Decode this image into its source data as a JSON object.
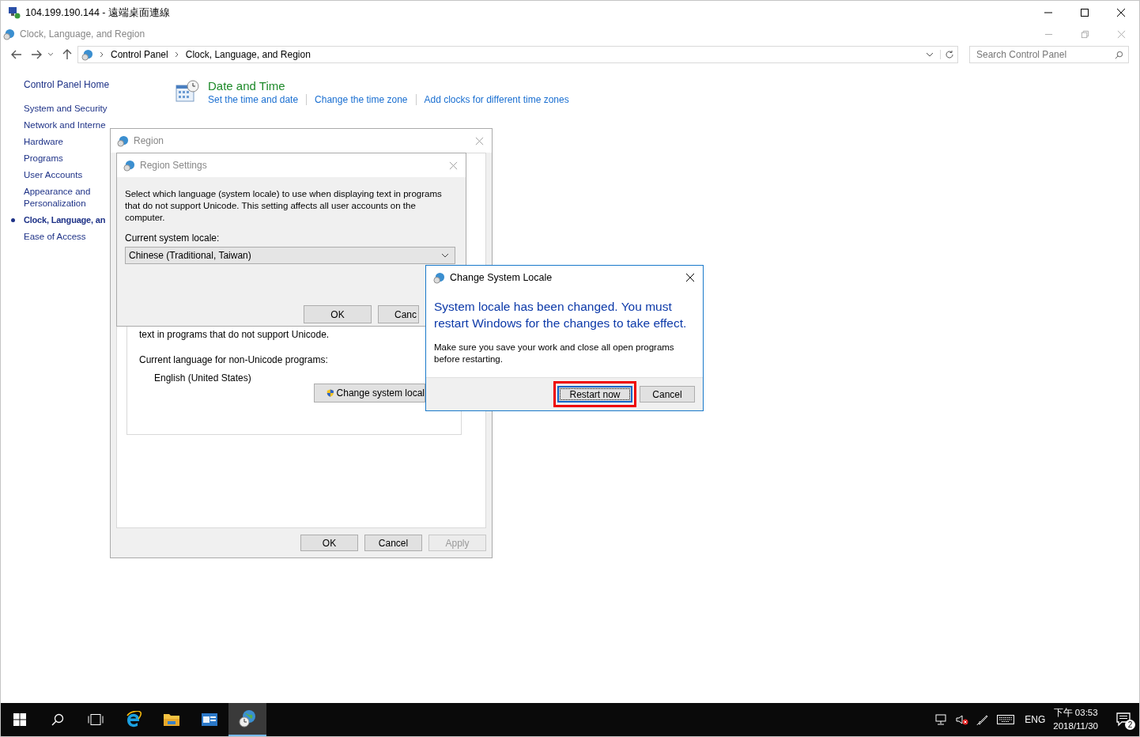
{
  "rdp_window": {
    "title": "104.199.190.144 - 遠端桌面連線"
  },
  "explorer": {
    "title": "Clock, Language, and Region",
    "breadcrumb": [
      "Control Panel",
      "Clock, Language, and Region"
    ],
    "search": {
      "placeholder": "Search Control Panel"
    }
  },
  "sidebar": {
    "home": "Control Panel Home",
    "items": [
      {
        "label": "System and Security",
        "selected": false
      },
      {
        "label": "Network and Interne",
        "selected": false
      },
      {
        "label": "Hardware",
        "selected": false
      },
      {
        "label": "Programs",
        "selected": false
      },
      {
        "label": "User Accounts",
        "selected": false
      },
      {
        "label": "Appearance and Personalization",
        "selected": false
      },
      {
        "label": "Clock, Language, an",
        "selected": true
      },
      {
        "label": "Ease of Access",
        "selected": false
      }
    ]
  },
  "categories": [
    {
      "title": "Date and Time",
      "links": [
        "Set the time and date",
        "Change the time zone",
        "Add clocks for different time zones"
      ]
    }
  ],
  "region_dialog": {
    "title": "Region",
    "partial_text": "text in programs that do not support Unicode.",
    "label": "Current language for non-Unicode programs:",
    "value": "English (United States)",
    "change_button": "Change system local",
    "buttons": [
      {
        "label": "OK",
        "disabled": false
      },
      {
        "label": "Cancel",
        "disabled": false
      },
      {
        "label": "Apply",
        "disabled": true
      }
    ]
  },
  "region_settings": {
    "title": "Region Settings",
    "description": "Select which language (system locale) to use when displaying text in programs that do not support Unicode. This setting affects all user accounts on the computer.",
    "locale_label": "Current system locale:",
    "locale_value": "Chinese (Traditional, Taiwan)",
    "buttons": [
      "OK",
      "Canc"
    ]
  },
  "locale_dialog": {
    "title": "Change System Locale",
    "headline": "System locale has been changed. You must restart Windows for the changes to take effect.",
    "message": "Make sure you save your work and close all open programs before restarting.",
    "buttons": [
      {
        "label": "Restart now",
        "focused": true,
        "highlighted": true
      },
      {
        "label": "Cancel",
        "focused": false,
        "highlighted": false
      }
    ]
  },
  "taskbar": {
    "apps": [
      {
        "kind": "search",
        "active": false
      },
      {
        "kind": "taskview",
        "active": false
      },
      {
        "kind": "ie",
        "active": false
      },
      {
        "kind": "explorer",
        "active": false
      },
      {
        "kind": "app",
        "active": false
      },
      {
        "kind": "controlpanel",
        "active": true
      }
    ],
    "language": "ENG",
    "time": "下午 03:53",
    "date": "2018/11/30",
    "notifications": "2"
  }
}
